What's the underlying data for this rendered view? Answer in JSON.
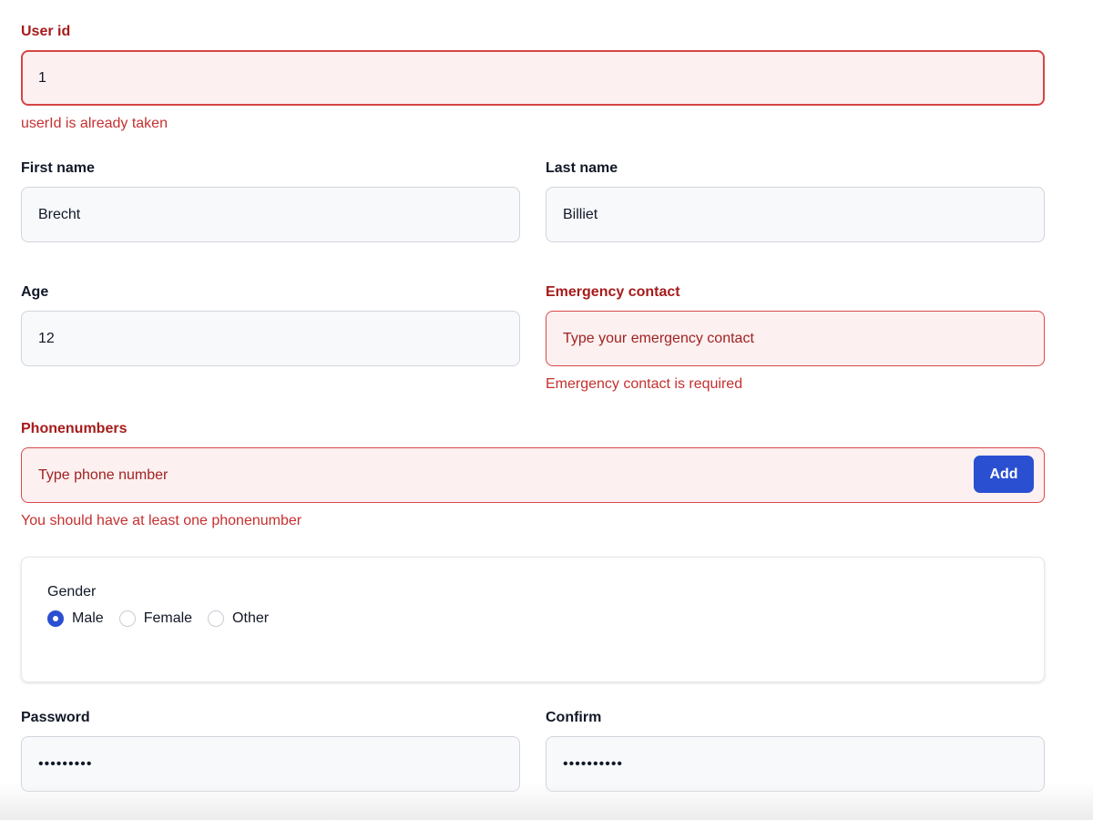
{
  "user_id": {
    "label": "User id",
    "value": "1",
    "error": "userId is already taken"
  },
  "first_name": {
    "label": "First name",
    "value": "Brecht"
  },
  "last_name": {
    "label": "Last name",
    "value": "Billiet"
  },
  "age": {
    "label": "Age",
    "value": "12"
  },
  "emergency_contact": {
    "label": "Emergency contact",
    "placeholder": "Type your emergency contact",
    "error": "Emergency contact is required"
  },
  "phonenumbers": {
    "label": "Phonenumbers",
    "placeholder": "Type phone number",
    "add_label": "Add",
    "error": "You should have at least one phonenumber"
  },
  "gender": {
    "legend": "Gender",
    "options": [
      "Male",
      "Female",
      "Other"
    ],
    "selected": "Male"
  },
  "password": {
    "label": "Password",
    "value": "•••••••••"
  },
  "confirm": {
    "label": "Confirm",
    "value": "••••••••••"
  },
  "colors": {
    "error_text": "#a61b1b",
    "error_bg": "#fcf0f0",
    "primary": "#2b4fd1"
  }
}
